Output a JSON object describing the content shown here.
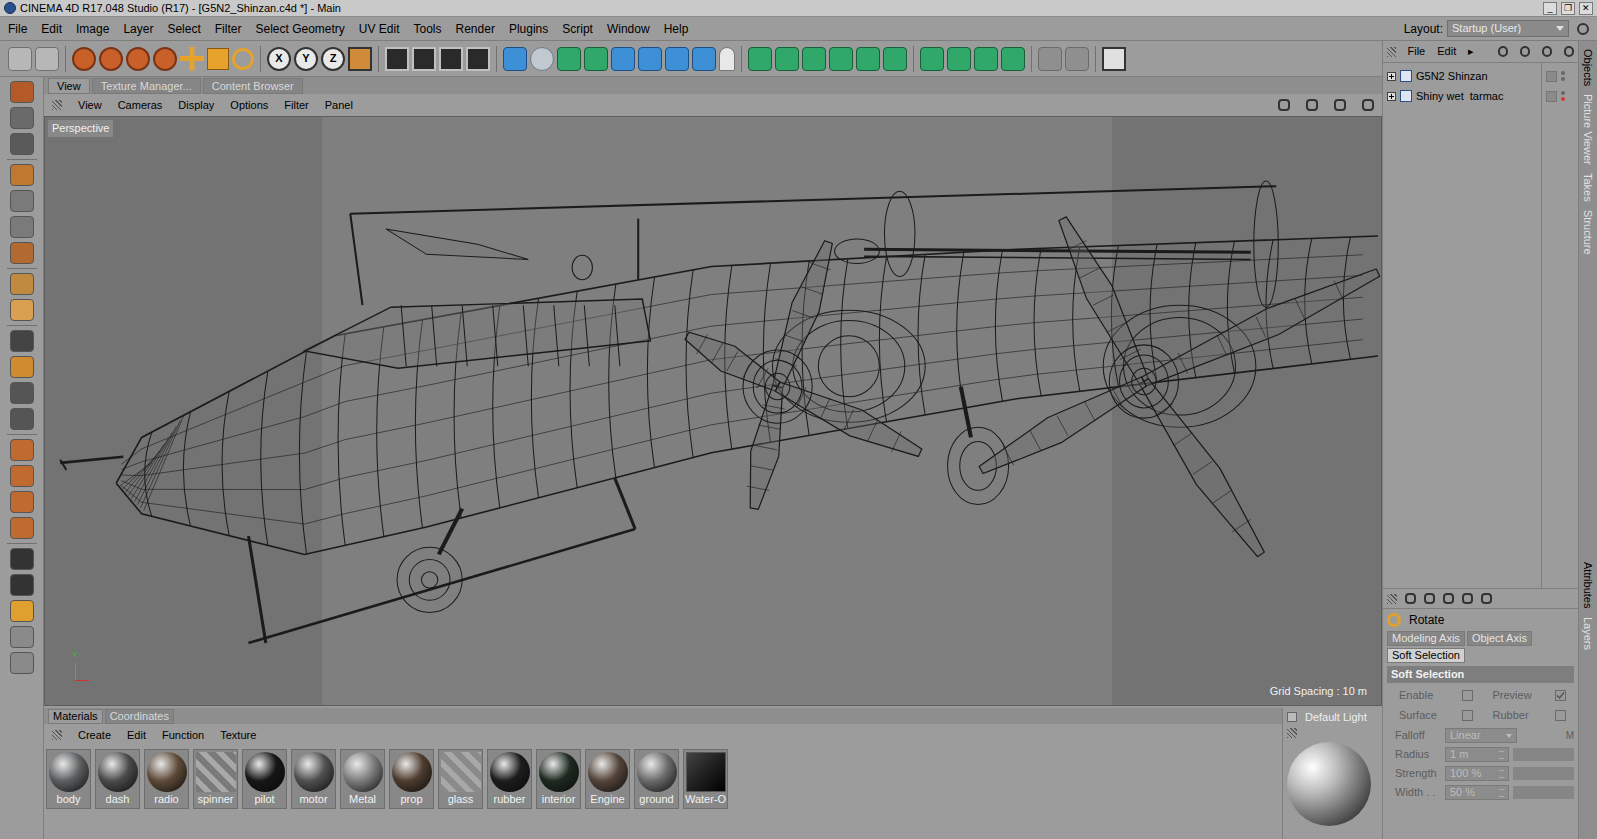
{
  "window": {
    "title": "CINEMA 4D R17.048 Studio (R17) - [G5N2_Shinzan.c4d *] - Main",
    "controls": [
      "_",
      "❐",
      "✕"
    ]
  },
  "menu": [
    "File",
    "Edit",
    "Image",
    "Layer",
    "Select",
    "Filter",
    "Select Geometry",
    "UV Edit",
    "Tools",
    "Render",
    "Plugins",
    "Script",
    "Window",
    "Help"
  ],
  "layout": {
    "label": "Layout:",
    "value": "Startup (User)"
  },
  "toolbar": {
    "axis_buttons": [
      "X",
      "Y",
      "Z"
    ]
  },
  "view_tabs": [
    {
      "label": "View",
      "selected": true
    },
    {
      "label": "Texture Manager...",
      "selected": false
    },
    {
      "label": "Content Browser",
      "selected": false
    }
  ],
  "viewport": {
    "menu": [
      "View",
      "Cameras",
      "Display",
      "Options",
      "Filter",
      "Panel"
    ],
    "camera": "Perspective",
    "grid_spacing": "Grid Spacing : 10 m",
    "axis_label": "Y"
  },
  "objects": {
    "menu": [
      "File",
      "Edit",
      "▸"
    ],
    "items": [
      {
        "name": "G5N2 Shinzan",
        "expanded": false
      },
      {
        "name": "Shiny wet  tarmac",
        "expanded": false
      }
    ]
  },
  "side_tabs": [
    "Objects",
    "Picture Viewer",
    "Takes",
    "Structure",
    "Attributes",
    "Layers"
  ],
  "attributes": {
    "mode": "Rotate",
    "tabs": [
      {
        "label": "Modeling Axis",
        "selected": false
      },
      {
        "label": "Object Axis",
        "selected": false
      },
      {
        "label": "Soft Selection",
        "selected": true
      }
    ],
    "section": "Soft Selection",
    "checkboxes": [
      {
        "label": "Enable",
        "checked": false
      },
      {
        "label": "Preview",
        "checked": true
      },
      {
        "label": "Surface",
        "checked": false
      },
      {
        "label": "Rubber",
        "checked": false
      }
    ],
    "falloff": {
      "label": "Falloff",
      "value": "Linear",
      "disabled": true,
      "extra": "M"
    },
    "numbers": [
      {
        "label": "Radius",
        "value": "1 m",
        "disabled": true
      },
      {
        "label": "Strength",
        "value": "100 %",
        "disabled": true
      },
      {
        "label": "Width . .",
        "value": "50 %",
        "disabled": true
      }
    ]
  },
  "materials": {
    "tabs": [
      {
        "label": "Materials",
        "selected": true
      },
      {
        "label": "Coordinates",
        "selected": false
      }
    ],
    "menu": [
      "Create",
      "Edit",
      "Function",
      "Texture"
    ],
    "items": [
      {
        "name": "body",
        "color": "#5c5e60",
        "kind": "sphere"
      },
      {
        "name": "dash",
        "color": "#4a4a4a",
        "kind": "sphere"
      },
      {
        "name": "radio",
        "color": "#5e4a38",
        "kind": "sphere"
      },
      {
        "name": "spinner",
        "color": "#7a7a7a",
        "kind": "checker"
      },
      {
        "name": "pilot",
        "color": "#161616",
        "kind": "sphere"
      },
      {
        "name": "motor",
        "color": "#505050",
        "kind": "sphere"
      },
      {
        "name": "Metal",
        "color": "#7c7c7c",
        "kind": "sphere"
      },
      {
        "name": "prop",
        "color": "#4e3c2e",
        "kind": "sphere"
      },
      {
        "name": "glass",
        "color": "#8a8a8a",
        "kind": "checker"
      },
      {
        "name": "rubber",
        "color": "#1c1c1c",
        "kind": "sphere"
      },
      {
        "name": "interior",
        "color": "#1e2a20",
        "kind": "sphere"
      },
      {
        "name": "Engine",
        "color": "#54443a",
        "kind": "sphere"
      },
      {
        "name": "ground",
        "color": "#6a6a6a",
        "kind": "sphere"
      },
      {
        "name": "Water-O",
        "color": "#202020",
        "kind": "cube"
      }
    ]
  },
  "preview": {
    "label": "Default Light"
  }
}
